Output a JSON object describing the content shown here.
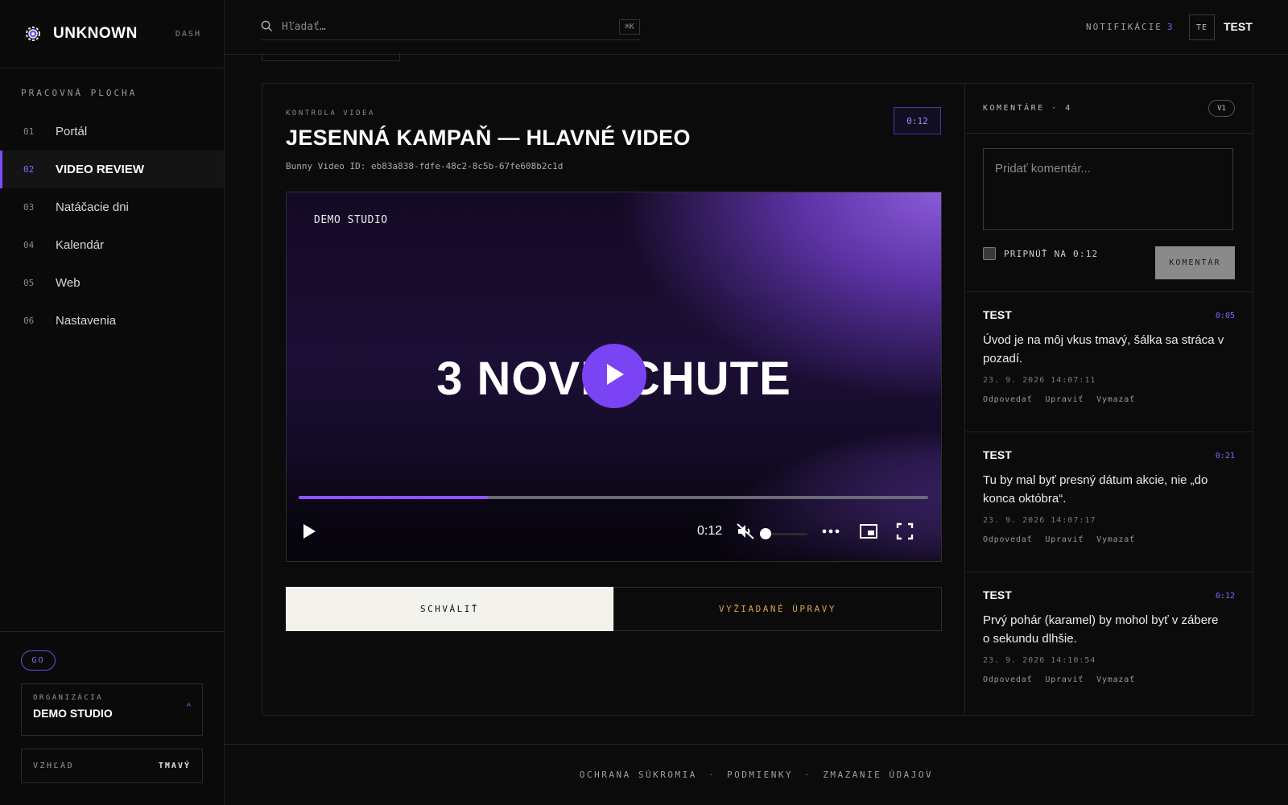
{
  "brand": {
    "name": "UNKNOWN",
    "tag": "DASH"
  },
  "sidebar": {
    "section_label": "PRACOVNÁ PLOCHA",
    "items": [
      {
        "num": "01",
        "label": "Portál",
        "active": false
      },
      {
        "num": "02",
        "label": "VIDEO REVIEW",
        "active": true
      },
      {
        "num": "03",
        "label": "Natáčacie dni",
        "active": false
      },
      {
        "num": "04",
        "label": "Kalendár",
        "active": false
      },
      {
        "num": "05",
        "label": "Web",
        "active": false
      },
      {
        "num": "06",
        "label": "Nastavenia",
        "active": false
      }
    ],
    "go_badge": "GO",
    "org_label": "ORGANIZÁCIA",
    "org_name": "DEMO STUDIO",
    "org_chevron": "^",
    "theme_label": "VZHĽAD",
    "theme_value": "TMAVÝ"
  },
  "header": {
    "search_placeholder": "Hľadať…",
    "search_shortcut": "⌘K",
    "notifications_label": "NOTIFIKÁCIE",
    "notifications_count": "3",
    "avatar_initials": "TE",
    "user_name": "TEST"
  },
  "review": {
    "eyebrow": "KONTROLA VIDEA",
    "title": "JESENNÁ KAMPAŇ — HLAVNÉ VIDEO",
    "video_id": "Bunny Video ID: eb83a838-fdfe-48c2-8c5b-67fe608b2c1d",
    "time_badge": "0:12",
    "video": {
      "studio_overlay": "DEMO STUDIO",
      "headline": "3 NOVÉ CHUTE",
      "current_time": "0:12",
      "progress_fraction": 0.3,
      "volume_fraction": 0.0,
      "muted": true
    },
    "approve_label": "SCHVÁLIŤ",
    "changes_label": "VYŽIADANÉ ÚPRAVY"
  },
  "comments": {
    "title": "KOMENTÁRE · 4",
    "version": "V1",
    "placeholder": "Pridať komentár...",
    "pin_label": "PRIPNÚŤ NA 0:12",
    "submit_label": "KOMENTÁR",
    "items": [
      {
        "author": "TEST",
        "time": "0:05",
        "text": "Úvod je na môj vkus tmavý, šálka sa stráca v pozadí.",
        "date": "23. 9. 2026 14:07:11"
      },
      {
        "author": "TEST",
        "time": "0:21",
        "text": "Tu by mal byť presný dátum akcie, nie „do konca októbra“.",
        "date": "23. 9. 2026 14:07:17"
      },
      {
        "author": "TEST",
        "time": "0:12",
        "text": "Prvý pohár (karamel) by mohol byť v zábere o sekundu dlhšie.",
        "date": "23. 9. 2026 14:10:54"
      }
    ],
    "actions": {
      "reply": "Odpovedať",
      "edit": "Upraviť",
      "delete": "Vymazať"
    }
  },
  "footer": {
    "privacy": "OCHRANA SÚKROMIA",
    "terms": "PODMIENKY",
    "delete_data": "ZMAZANIE ÚDAJOV",
    "separator": "·"
  },
  "colors": {
    "accent": "#7b4dff",
    "warning": "#d6a545",
    "background": "#0b0b0b"
  }
}
